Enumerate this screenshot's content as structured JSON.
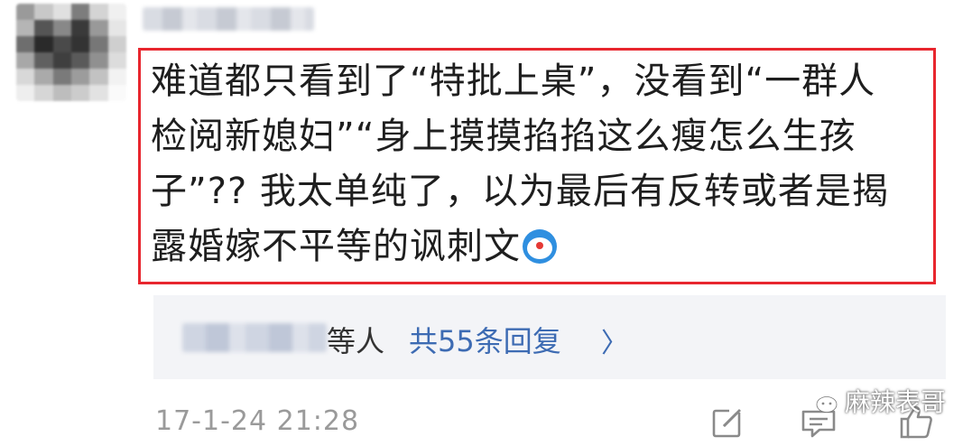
{
  "comment": {
    "lines": [
      "难道都只看到了“特批上桌”，没看到“一群人",
      "检阅新媳妇”“身上摸摸掐掐这么瘦怎么生孩",
      "子”?? 我太单纯了，以为最后有反转或者是揭",
      "露婚嫁不平等的讽刺文"
    ],
    "emoji": "doraemon-emoji"
  },
  "replies": {
    "suffix": "等人",
    "link": "共55条回复",
    "chevron": "〉"
  },
  "timestamp": "17-1-24 21:28",
  "actions": {
    "icons": [
      "edit-icon",
      "comment-icon",
      "like-icon"
    ]
  },
  "watermark": {
    "text": "麻辣表哥",
    "logo": "wechat-logo"
  },
  "colors": {
    "highlight_border": "#e8262e",
    "link": "#3d6bb3",
    "reply_bg": "#f3f4f7",
    "muted": "#9a9a9a"
  }
}
